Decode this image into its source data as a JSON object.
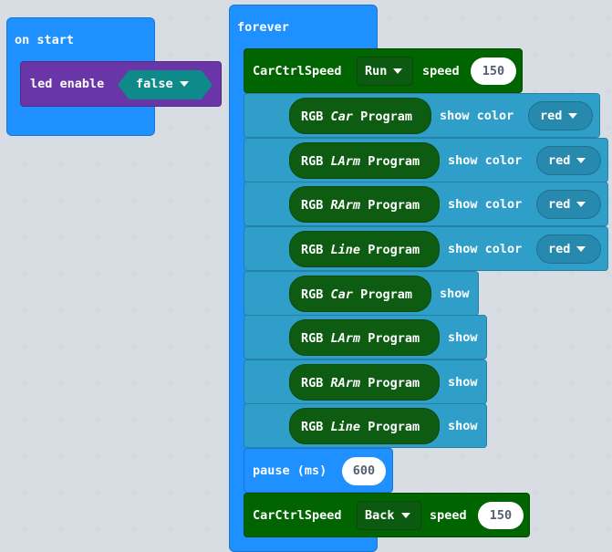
{
  "on_start": {
    "title": "on start",
    "led_block": {
      "label": "led enable",
      "value": "false"
    }
  },
  "forever": {
    "title": "forever",
    "car_speed_1": {
      "label": "CarCtrlSpeed",
      "direction": "Run",
      "speed_label": "speed",
      "speed": "150"
    },
    "rgb_color_blocks": [
      {
        "rgb": "RGB",
        "target": "Car",
        "program": "Program",
        "action": "show color",
        "color": "red"
      },
      {
        "rgb": "RGB",
        "target": "LArm",
        "program": "Program",
        "action": "show color",
        "color": "red"
      },
      {
        "rgb": "RGB",
        "target": "RArm",
        "program": "Program",
        "action": "show color",
        "color": "red"
      },
      {
        "rgb": "RGB",
        "target": "Line",
        "program": "Program",
        "action": "show color",
        "color": "red"
      }
    ],
    "rgb_show_blocks": [
      {
        "rgb": "RGB",
        "target": "Car",
        "program": "Program",
        "action": "show"
      },
      {
        "rgb": "RGB",
        "target": "LArm",
        "program": "Program",
        "action": "show"
      },
      {
        "rgb": "RGB",
        "target": "RArm",
        "program": "Program",
        "action": "show"
      },
      {
        "rgb": "RGB",
        "target": "Line",
        "program": "Program",
        "action": "show"
      }
    ],
    "pause": {
      "label": "pause (ms)",
      "value": "600"
    },
    "car_speed_2": {
      "label": "CarCtrlSpeed",
      "direction": "Back",
      "speed_label": "speed",
      "speed": "150"
    }
  },
  "colors": {
    "event": "#1e90ff",
    "led": "#6a35a6",
    "car": "#006400",
    "rgb": "#2f9fc9",
    "workspace": "#ecf0f1"
  }
}
